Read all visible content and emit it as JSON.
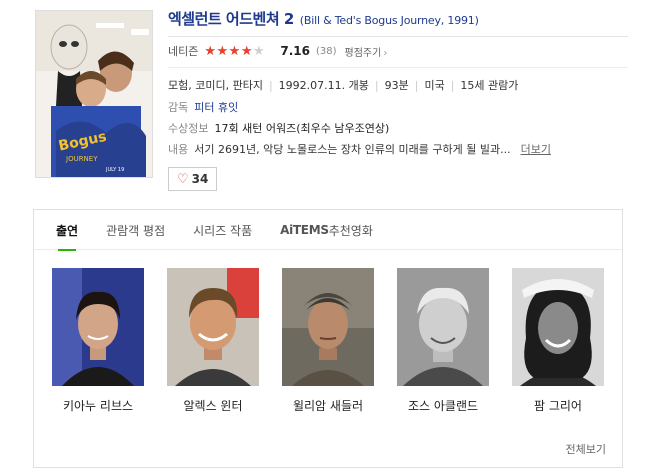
{
  "movie": {
    "title_ko": "엑셀런트 어드벤쳐 2",
    "title_en": "(Bill & Ted's Bogus Journey, 1991)",
    "rating_label": "네티즌",
    "rating_score": "7.16",
    "rating_fraction": 0.716,
    "rating_count": "(38)",
    "rate_link": "평점주기",
    "genres": "모험, 코미디, 판타지",
    "release_date": "1992.07.11. 개봉",
    "runtime": "93분",
    "country": "미국",
    "age_rating": "15세 관람가",
    "director_label": "감독",
    "director": "피터 휴잇",
    "awards_label": "수상정보",
    "awards": "17회 새턴 어워즈(최우수 남우조연상)",
    "synopsis_label": "내용",
    "synopsis": "서기 2691년, 악당 노몰로스는 장차 인류의 미래를 구하게 될 빌과...",
    "more_link": "더보기",
    "likes": "34"
  },
  "tabs": [
    {
      "label": "출연"
    },
    {
      "label": "관람객 평점"
    },
    {
      "label": "시리즈 작품"
    },
    {
      "brand": "AiTEMS",
      "label": " 추천영화"
    }
  ],
  "cast": [
    {
      "name": "키아누 리브스"
    },
    {
      "name": "알렉스 윈터"
    },
    {
      "name": "윌리암 새들러"
    },
    {
      "name": "조스 아클랜드"
    },
    {
      "name": "팜 그리어"
    }
  ],
  "view_all": "전체보기",
  "colors": {
    "title": "#1d3a8f",
    "star": "#e8412c",
    "active_tab": "#2db400",
    "heart": "#e0433b"
  }
}
